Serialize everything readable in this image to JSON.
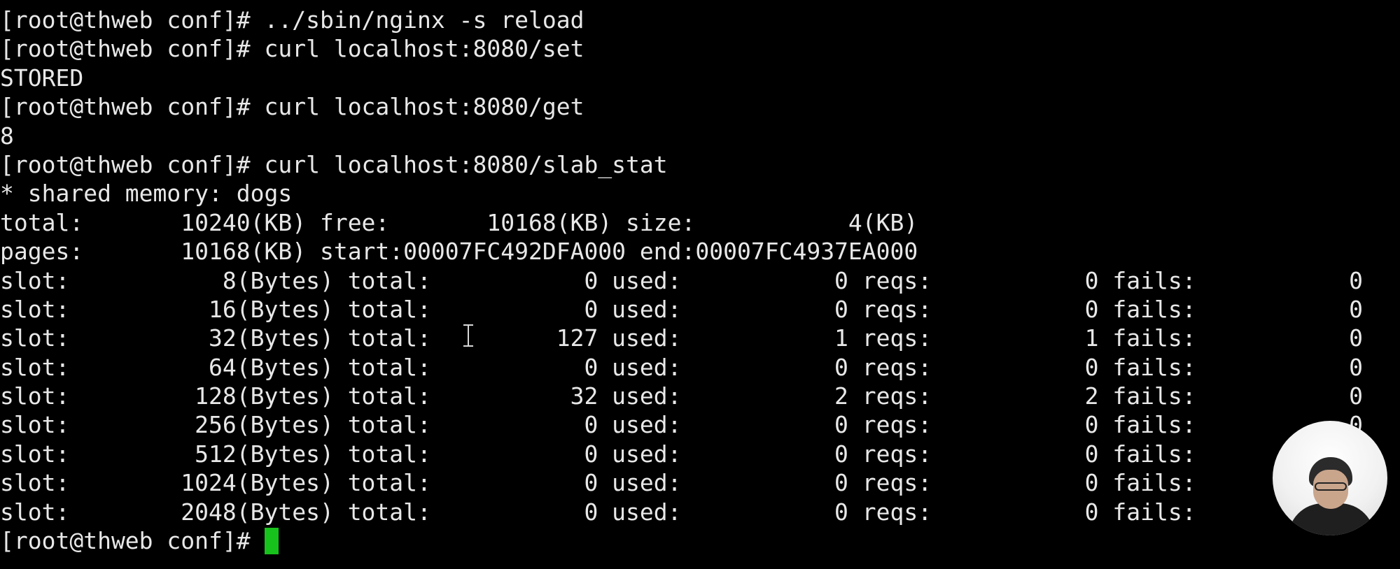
{
  "terminal": {
    "lines": [
      "[root@thweb conf]# ../sbin/nginx -s reload",
      "[root@thweb conf]# curl localhost:8080/set",
      "STORED",
      "[root@thweb conf]# curl localhost:8080/get",
      "8",
      "[root@thweb conf]# curl localhost:8080/slab_stat",
      "* shared memory: dogs",
      "total:       10240(KB) free:       10168(KB) size:           4(KB)",
      "pages:       10168(KB) start:00007FC492DFA000 end:00007FC4937EA000",
      "slot:           8(Bytes) total:           0 used:           0 reqs:           0 fails:           0",
      "slot:          16(Bytes) total:           0 used:           0 reqs:           0 fails:           0",
      "slot:          32(Bytes) total:         127 used:           1 reqs:           1 fails:           0",
      "slot:          64(Bytes) total:           0 used:           0 reqs:           0 fails:           0",
      "slot:         128(Bytes) total:          32 used:           2 reqs:           2 fails:           0",
      "slot:         256(Bytes) total:           0 used:           0 reqs:           0 fails:           0",
      "slot:         512(Bytes) total:           0 used:           0 reqs:           0 fails:",
      "slot:        1024(Bytes) total:           0 used:           0 reqs:           0 fails:",
      "slot:        2048(Bytes) total:           0 used:           0 reqs:           0 fails:"
    ],
    "prompt": "[root@thweb conf]# ",
    "colors": {
      "background": "#000000",
      "foreground": "#e8e8e8",
      "cursor": "#18c21c"
    }
  },
  "overlay": {
    "mouse_cursor_icon": "text-ibeam-icon",
    "webcam": "webcam-presenter"
  }
}
